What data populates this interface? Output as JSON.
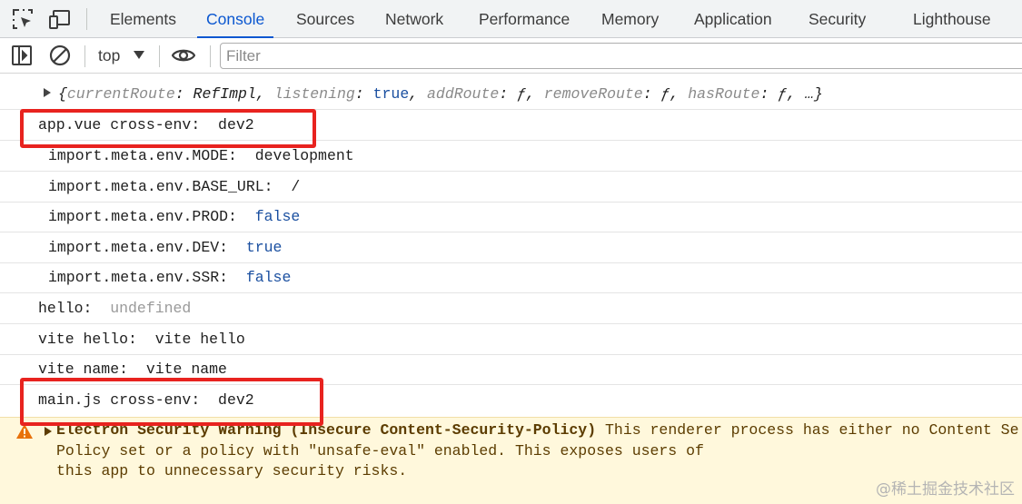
{
  "tabs": {
    "items": [
      "Elements",
      "Console",
      "Sources",
      "Network",
      "Performance",
      "Memory",
      "Application",
      "Security",
      "Lighthouse"
    ],
    "active": "Console"
  },
  "toolbar": {
    "context": "top",
    "filter_placeholder": "Filter"
  },
  "logs": {
    "obj_prefix": "{",
    "obj_k1": "currentRoute",
    "obj_v1": "RefImpl",
    "obj_k2": "listening",
    "obj_v2": "true",
    "obj_k3": "addRoute",
    "obj_v3": "ƒ",
    "obj_k4": "removeRoute",
    "obj_v4": "ƒ",
    "obj_k5": "hasRoute",
    "obj_v5": "ƒ",
    "obj_suffix": "…}",
    "app_cross_env_label": "app.vue cross-env: ",
    "app_cross_env_value": "dev2",
    "mode_label": "import.meta.env.MODE: ",
    "mode_value": "development",
    "base_url_label": "import.meta.env.BASE_URL: ",
    "base_url_value": "/",
    "prod_label": "import.meta.env.PROD: ",
    "prod_value": "false",
    "dev_label": "import.meta.env.DEV: ",
    "dev_value": "true",
    "ssr_label": "import.meta.env.SSR: ",
    "ssr_value": "false",
    "hello_label": "hello: ",
    "hello_value": "undefined",
    "vite_hello_label": "vite hello: ",
    "vite_hello_value": "vite hello",
    "vite_name_label": "vite name: ",
    "vite_name_value": "vite name",
    "main_cross_env_label": "main.js cross-env: ",
    "main_cross_env_value": "dev2"
  },
  "warning": {
    "title": "Electron Security Warning (Insecure Content-Security-Policy)",
    "line1_rest": " This renderer process has either no Content Se",
    "line2": "Policy set or a policy with \"unsafe-eval\" enabled. This exposes users of",
    "line3": "this app to unnecessary security risks."
  },
  "watermark": "@稀土掘金技术社区",
  "colors": {
    "active_tab": "#0b57d0",
    "annotation_box": "#e8231f",
    "warning_bg": "#fff8dc",
    "boolean": "#1a4fa0"
  }
}
